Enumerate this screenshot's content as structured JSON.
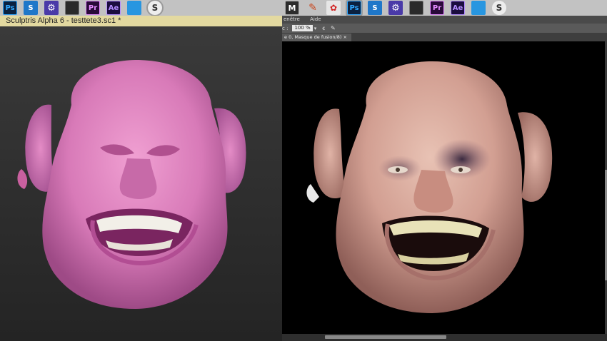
{
  "left_window": {
    "taskbar_icons": [
      {
        "name": "photoshop-icon",
        "label": "Ps",
        "active": false
      },
      {
        "name": "sculptris-s-icon",
        "label": "S",
        "active": false
      },
      {
        "name": "gear-icon",
        "label": "⚙",
        "active": false
      },
      {
        "name": "camera-app-icon",
        "label": "",
        "active": false
      },
      {
        "name": "premiere-icon",
        "label": "Pr",
        "active": false
      },
      {
        "name": "after-effects-icon",
        "label": "Ae",
        "active": false
      },
      {
        "name": "window-icon",
        "label": "",
        "active": false
      },
      {
        "name": "sculptris-icon",
        "label": "S",
        "active": true
      }
    ],
    "title": "Sculptris Alpha 6 - testtete3.sc1 *"
  },
  "right_window": {
    "taskbar_icons": [
      {
        "name": "m-app-icon",
        "label": "M",
        "active": false
      },
      {
        "name": "pencil-icon",
        "label": "✎",
        "active": false
      },
      {
        "name": "bug-app-icon",
        "label": "✿",
        "active": false
      },
      {
        "name": "photoshop-icon",
        "label": "Ps",
        "active": true
      },
      {
        "name": "sculptris-s-icon",
        "label": "S",
        "active": false
      },
      {
        "name": "gear-icon",
        "label": "⚙",
        "active": false
      },
      {
        "name": "camera-app-icon",
        "label": "",
        "active": false
      },
      {
        "name": "premiere-icon",
        "label": "Pr",
        "active": false
      },
      {
        "name": "after-effects-icon",
        "label": "Ae",
        "active": false
      },
      {
        "name": "window-icon",
        "label": "",
        "active": false
      },
      {
        "name": "sculptris-icon",
        "label": "S",
        "active": false
      }
    ],
    "menu": [
      "enêtre",
      "Aide"
    ],
    "options": {
      "prefix": "c :",
      "zoom": "100 %",
      "caret": "▾"
    },
    "tab_label": "e 0, Masque de fusion/8)",
    "tab_close": "×"
  },
  "colors": {
    "sculptris_title_bar": "#e3d9a0",
    "taskbar": "#c2c2c2",
    "photoshop_canvas": "#000000"
  }
}
